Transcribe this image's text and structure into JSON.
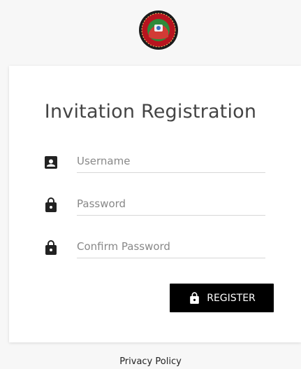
{
  "logo": {
    "name": "club-logo",
    "colors": {
      "ring": "#b8141f",
      "inner": "#2f8a3a",
      "center": "#c21f2a"
    }
  },
  "form": {
    "title": "Invitation Registration",
    "username": {
      "placeholder": "Username",
      "value": "",
      "icon": "account-box-icon"
    },
    "password": {
      "placeholder": "Password",
      "value": "",
      "icon": "lock-icon"
    },
    "confirm_password": {
      "placeholder": "Confirm Password",
      "value": "",
      "icon": "lock-icon"
    },
    "register_label": "REGISTER",
    "register_icon": "lock-icon"
  },
  "footer": {
    "privacy_label": "Privacy Policy"
  }
}
